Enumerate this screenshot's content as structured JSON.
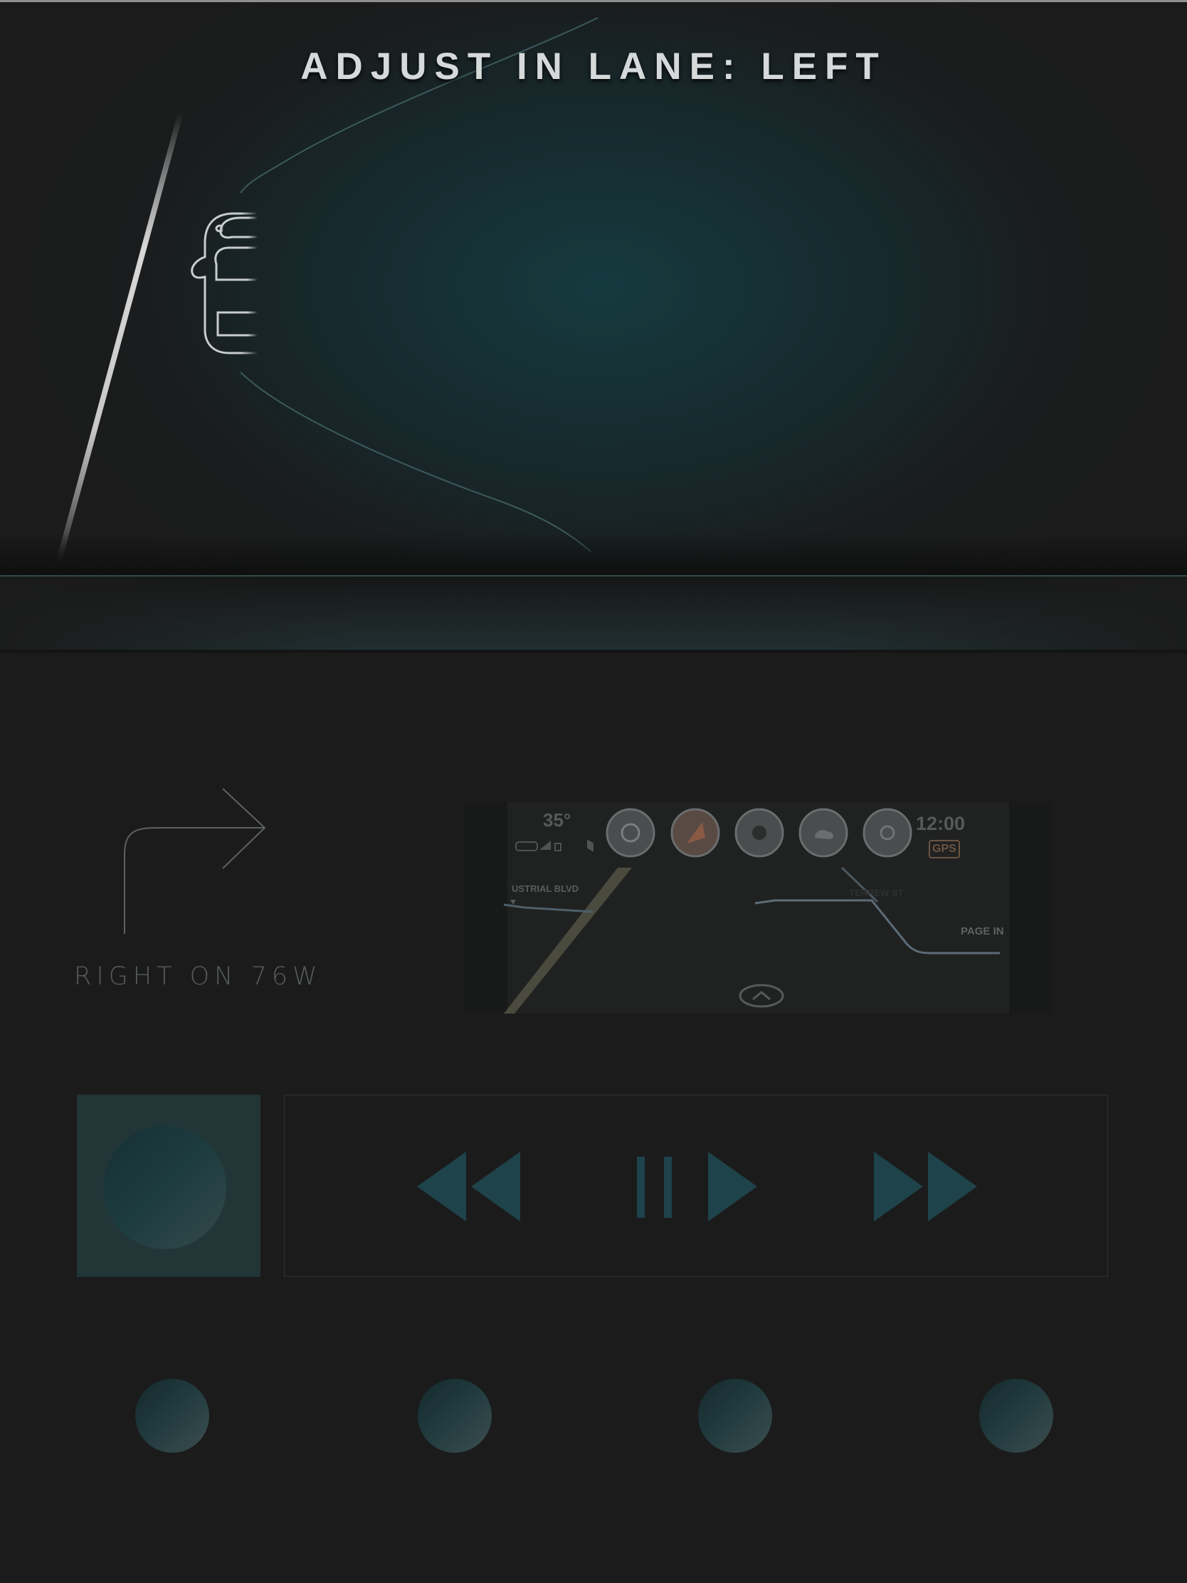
{
  "lane_assist": {
    "title": "ADJUST IN LANE: LEFT",
    "direction": "left"
  },
  "turn": {
    "instruction": "RIGHT ON 76W",
    "direction": "right"
  },
  "nav_preview": {
    "temperature": "35°",
    "time": "12:00",
    "gps_badge": "GPS",
    "streets": [
      "USTRIAL BLVD",
      "TERREW ST",
      "PAGE IN"
    ],
    "app_icons": [
      "phone-icon",
      "music-icon",
      "compass-icon",
      "weather-icon",
      "settings-icon"
    ]
  },
  "media": {
    "controls": [
      "rewind-icon",
      "play-pause-icon",
      "fast-forward-icon"
    ],
    "state": "paused"
  },
  "presets": {
    "count": 4
  },
  "colors": {
    "background": "#1b1b1b",
    "accent": "#1f4a50",
    "title": "#d5d9da",
    "muted_text": "#565b5c"
  }
}
